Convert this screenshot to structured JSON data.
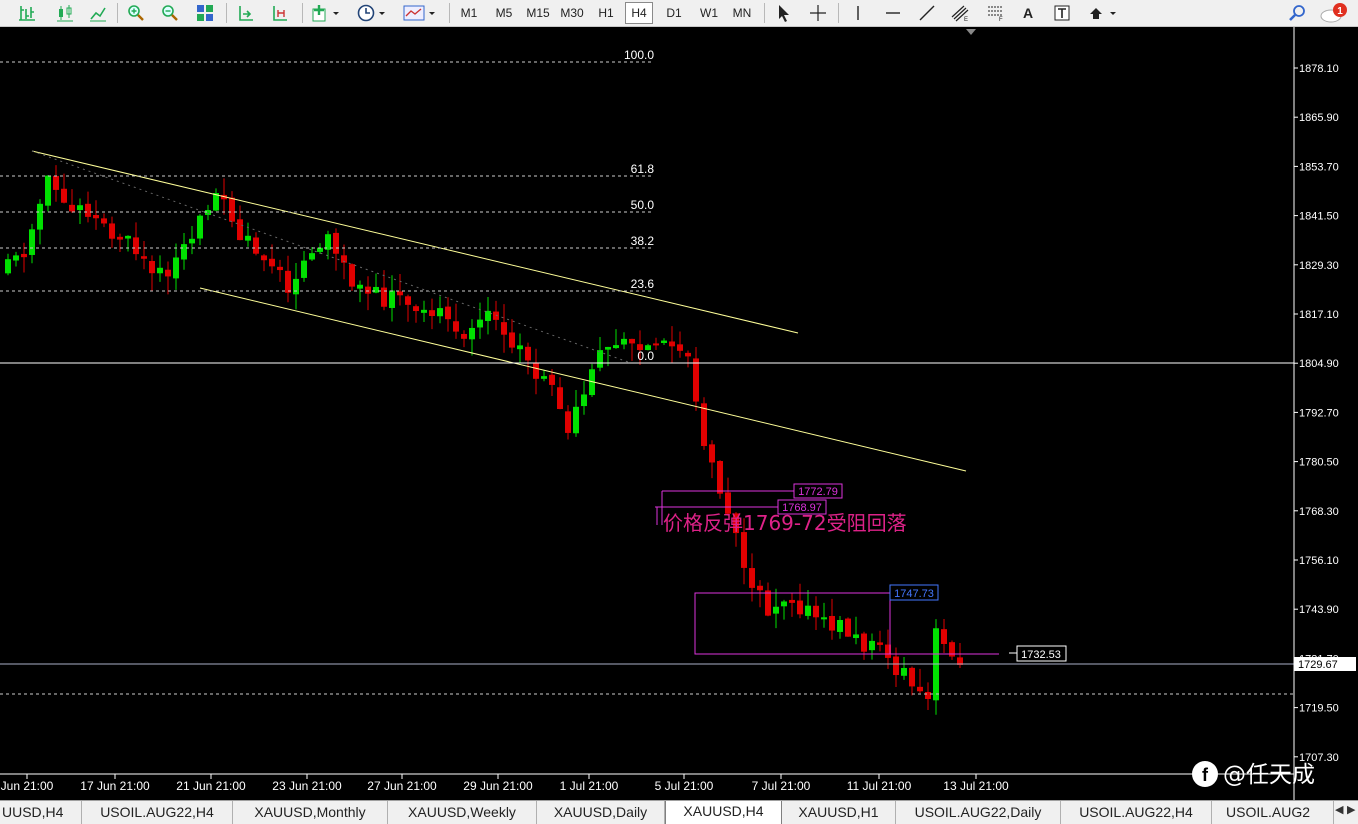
{
  "toolbar": {
    "timeframes": [
      "M1",
      "M5",
      "M15",
      "M30",
      "H1",
      "H4",
      "D1",
      "W1",
      "MN"
    ],
    "active_timeframe": "H4",
    "text_tool_label": "A",
    "notification_count": "1"
  },
  "chart": {
    "symbol": "XAUUSD,H4",
    "price_labels": [
      "1878.10",
      "1865.90",
      "1853.70",
      "1841.50",
      "1829.30",
      "1817.10",
      "1804.90",
      "1792.70",
      "1780.50",
      "1768.30",
      "1756.10",
      "1743.90",
      "1731.70",
      "1719.50",
      "1707.30"
    ],
    "current_price": "1729.67",
    "time_labels": [
      "Jun 21:00",
      "17 Jun 21:00",
      "21 Jun 21:00",
      "23 Jun 21:00",
      "27 Jun 21:00",
      "29 Jun 21:00",
      "1 Jul 21:00",
      "5 Jul 21:00",
      "7 Jul 21:00",
      "11 Jul 21:00",
      "13 Jul 21:00"
    ],
    "fib_levels": [
      "100.0",
      "61.8",
      "50.0",
      "38.2",
      "23.6",
      "0.0"
    ],
    "price_boxes": [
      "1772.79",
      "1768.97",
      "1747.73",
      "1732.53"
    ],
    "annotation": "价格反弹1769-72受阻回落",
    "watermark": "@任天成",
    "colors": {
      "bull": "#00e000",
      "bear": "#e00000",
      "channel": "#ffff99",
      "fib": "#cccccc",
      "marker": "#dd33dd",
      "annotation": "#dd2288",
      "box_blue": "#4477ff"
    }
  },
  "tabs": [
    "UUSD,H4",
    "USOIL.AUG22,H4",
    "XAUUSD,Monthly",
    "XAUUSD,Weekly",
    "XAUUSD,Daily",
    "XAUUSD,H4",
    "XAUUSD,H1",
    "USOIL.AUG22,Daily",
    "USOIL.AUG22,H4",
    "USOIL.AUG2"
  ],
  "active_tab": "XAUUSD,H4"
}
